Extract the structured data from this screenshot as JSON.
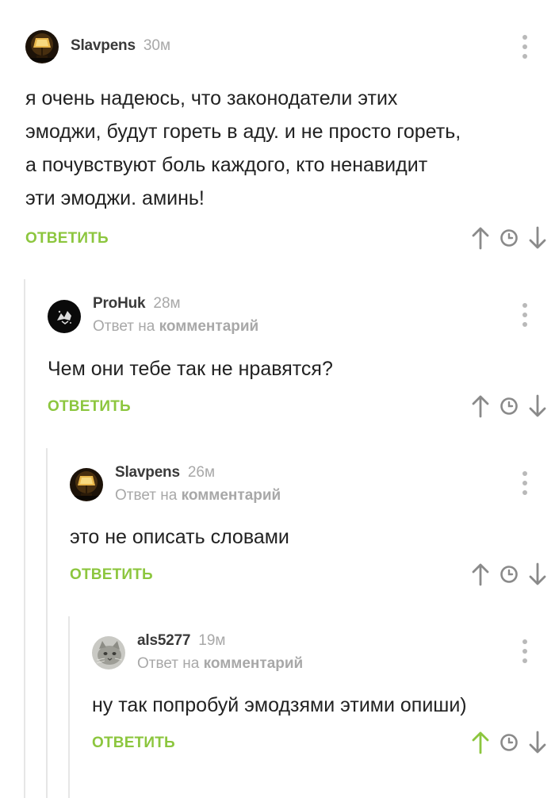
{
  "comments": [
    {
      "author": "Slavpens",
      "time": "30м",
      "reply_to": null,
      "text_lines": [
        "я очень надеюсь, что законодатели этих",
        "эмоджи, будут гореть в аду. и не просто гореть,",
        "а почувствуют боль каждого, кто ненавидит",
        "эти эмоджи. аминь!"
      ],
      "reply_label": "ОТВЕТИТЬ",
      "upvote_active": false,
      "avatar": "lamp-avatar"
    },
    {
      "author": "ProHuk",
      "time": "28м",
      "reply_to": {
        "prefix": "Ответ на",
        "target": "комментарий"
      },
      "text_lines": [
        "Чем они тебе так не нравятся?"
      ],
      "reply_label": "ОТВЕТИТЬ",
      "upvote_active": false,
      "avatar": "dark-avatar"
    },
    {
      "author": "Slavpens",
      "time": "26м",
      "reply_to": {
        "prefix": "Ответ на",
        "target": "комментарий"
      },
      "text_lines": [
        "это не описать словами"
      ],
      "reply_label": "ОТВЕТИТЬ",
      "upvote_active": false,
      "avatar": "lamp-avatar"
    },
    {
      "author": "als5277",
      "time": "19м",
      "reply_to": {
        "prefix": "Ответ на",
        "target": "комментарий"
      },
      "text_lines": [
        "ну так попробуй эмодзями этими опиши)"
      ],
      "reply_label": "ОТВЕТИТЬ",
      "upvote_active": true,
      "avatar": "cat-avatar"
    }
  ],
  "colors": {
    "accent": "#8cc63e",
    "icon_gray": "#8a8a8a",
    "meta_gray": "#a8a8a8",
    "text": "#222222",
    "thread_line": "#e6e6e6"
  }
}
